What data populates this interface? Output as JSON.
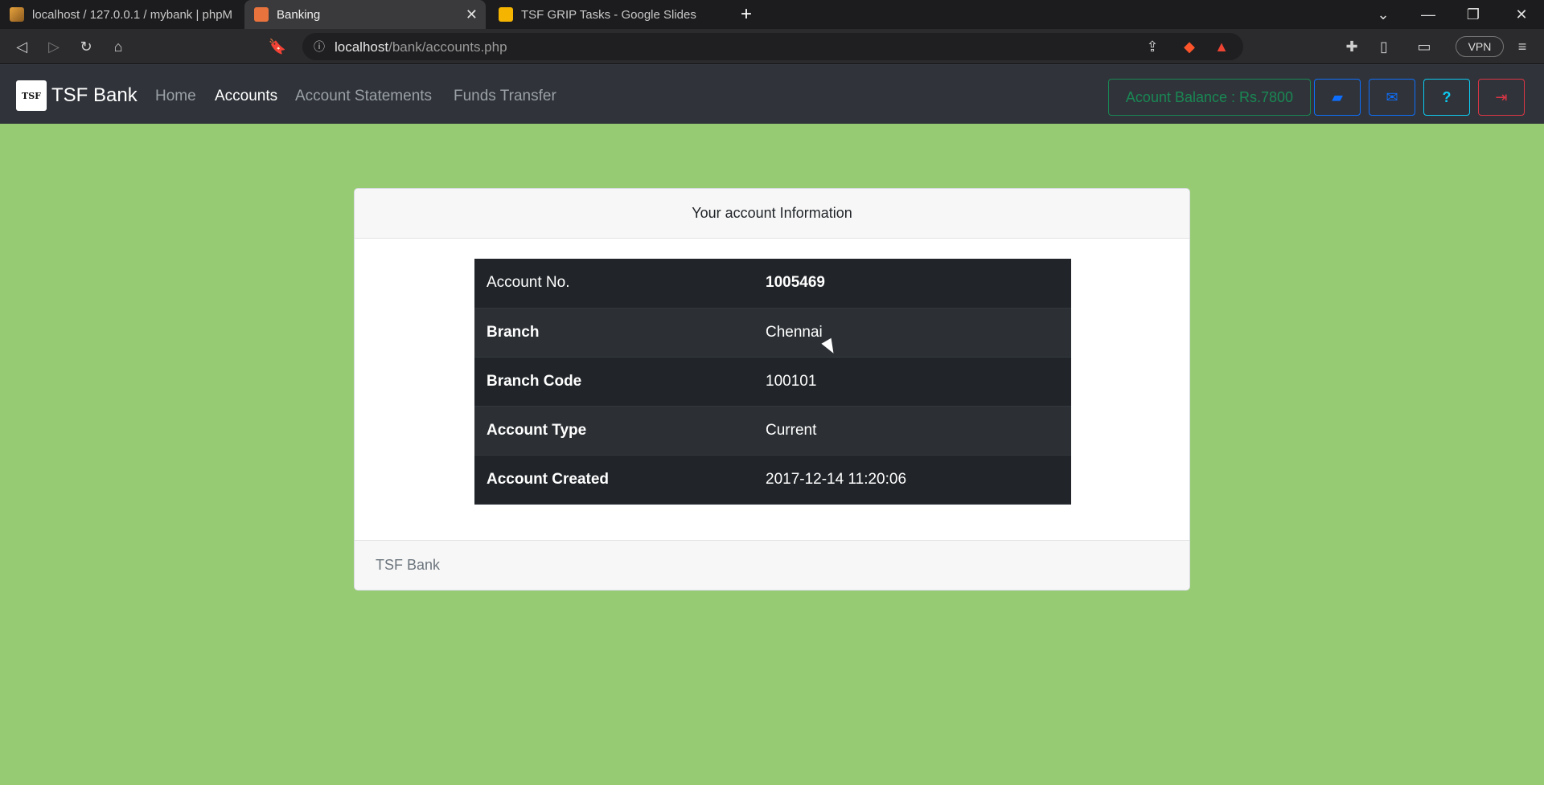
{
  "browser": {
    "tabs": [
      {
        "title": "localhost / 127.0.0.1 / mybank | phpM",
        "active": false
      },
      {
        "title": "Banking",
        "active": true
      },
      {
        "title": "TSF GRIP Tasks - Google Slides",
        "active": false
      }
    ],
    "url_host": "localhost",
    "url_path": "/bank/accounts.php",
    "vpn_label": "VPN",
    "new_tab": "+"
  },
  "navbar": {
    "brand_logo": "TSF",
    "brand": "TSF Bank",
    "links": [
      "Home",
      "Accounts",
      "Account Statements",
      "Funds Transfer"
    ],
    "active_link": "Accounts",
    "balance": "Acount Balance : Rs.7800"
  },
  "card": {
    "header": "Your account Information",
    "rows": [
      {
        "label": "Account No.",
        "value": "1005469"
      },
      {
        "label": "Branch",
        "value": "Chennai"
      },
      {
        "label": "Branch Code",
        "value": "100101"
      },
      {
        "label": "Account Type",
        "value": "Current"
      },
      {
        "label": "Account Created",
        "value": "2017-12-14 11:20:06"
      }
    ],
    "footer": "TSF Bank"
  },
  "colors": {
    "page_bg": "#96cb74",
    "navbar_bg": "#30343a",
    "success": "#198754",
    "primary": "#0d6efd",
    "info": "#0dcaf0",
    "danger": "#dc3545"
  }
}
